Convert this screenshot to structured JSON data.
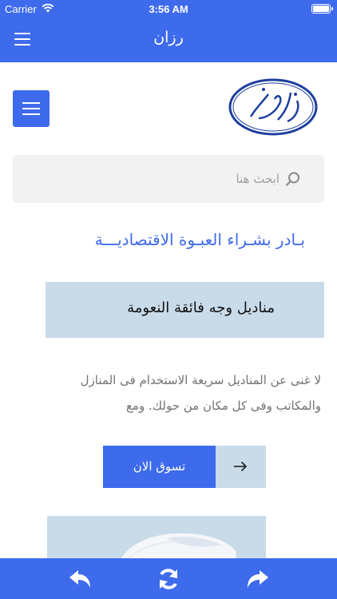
{
  "status_bar": {
    "carrier": "Carrier",
    "time": "3:56 AM"
  },
  "nav_bar": {
    "title": "رزان",
    "menu_icon": "hamburger-icon"
  },
  "search": {
    "placeholder": "ابحث هنا",
    "value": ""
  },
  "headline": "بـادر بشـراء العبـوة الاقتصاديـــة",
  "product": {
    "name": "مناديل وجه فائقة النعومة",
    "description": "لا غنى عن المناديل سريعة الاستخدام فى المنازل والمكاتب وفى كل مكان من حولك. ومع",
    "cta_label": "تسوق الان",
    "cta_icon": "arrow-right-icon"
  },
  "bottom_bar": {
    "back_icon": "undo-icon",
    "refresh_icon": "refresh-icon",
    "forward_icon": "redo-icon"
  },
  "colors": {
    "primary": "#3e6bec",
    "light_blue": "#c9dbe9",
    "search_bg": "#f2f2f3",
    "description_text": "#727272"
  }
}
